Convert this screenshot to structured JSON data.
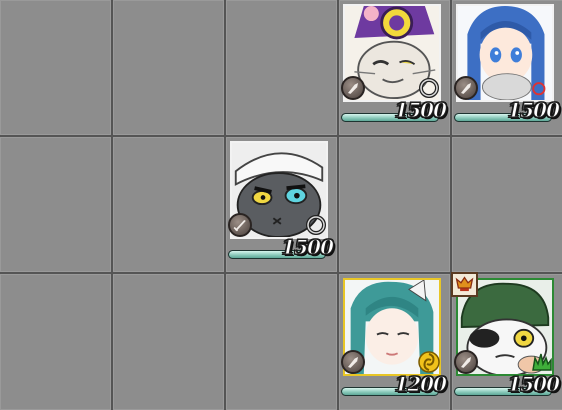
{
  "board": {
    "rows": 3,
    "cols": 5,
    "units": [
      {
        "row": 0,
        "col": 3,
        "hp": "1500",
        "hp_fraction": 1.0,
        "frame": "white",
        "type_icon": "axe-icon",
        "element_icon": "ring-icon",
        "portrait": "white-cat-purple-hat"
      },
      {
        "row": 0,
        "col": 4,
        "hp": "1500",
        "hp_fraction": 1.0,
        "frame": "white",
        "type_icon": "axe-icon",
        "element_icon": "ring-icon",
        "portrait": "blue-haired-girl-with-cat"
      },
      {
        "row": 1,
        "col": 2,
        "hp": "1500",
        "hp_fraction": 1.0,
        "frame": "white",
        "type_icon": "sword-icon",
        "element_icon": "ring-icon",
        "portrait": "gray-cat-bandana"
      },
      {
        "row": 2,
        "col": 3,
        "hp": "1200",
        "hp_fraction": 1.0,
        "frame": "gold",
        "type_icon": "axe-icon",
        "element_icon": "swirl-icon",
        "portrait": "teal-haired-cat-girl"
      },
      {
        "row": 2,
        "col": 4,
        "hp": "1500",
        "hp_fraction": 1.0,
        "frame": "green",
        "type_icon": "axe-icon",
        "element_icon": "grass-icon",
        "portrait": "eyepatch-cat-captain",
        "rank_icon": "rank-crest-icon"
      }
    ]
  },
  "colors": {
    "tile": "#8d8d8d",
    "grid_line": "#555555",
    "hp_bar": "#86c7b8",
    "frame_gold": "#e8c626",
    "frame_green": "#2c8a34"
  }
}
